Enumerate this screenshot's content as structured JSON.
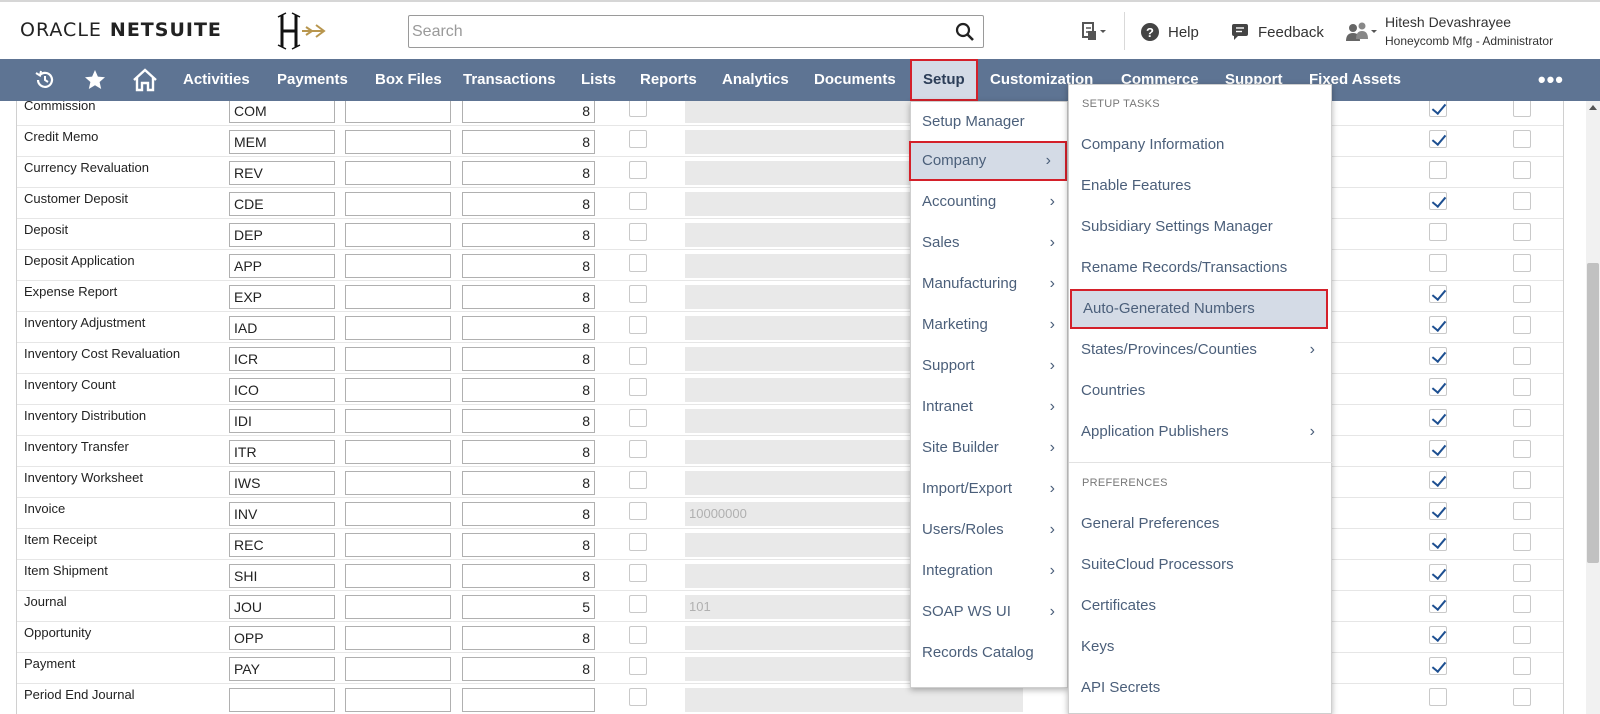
{
  "header": {
    "logo_oracle": "ORACLE",
    "logo_netsuite": "NETSUITE",
    "search_placeholder": "Search",
    "help_label": "Help",
    "feedback_label": "Feedback",
    "user_name": "Hitesh Devashrayee",
    "user_role": "Honeycomb Mfg - Administrator"
  },
  "nav": {
    "items": [
      "Activities",
      "Payments",
      "Box Files",
      "Transactions",
      "Lists",
      "Reports",
      "Analytics",
      "Documents",
      "Setup",
      "Customization",
      "Commerce",
      "Support",
      "Fixed Assets"
    ],
    "more": "•••"
  },
  "table": {
    "rows": [
      {
        "name": "Commission",
        "prefix": "COM",
        "suffix": "",
        "min_digits": "8",
        "initial": "",
        "use_a": true,
        "use_b": false
      },
      {
        "name": "Credit Memo",
        "prefix": "MEM",
        "suffix": "",
        "min_digits": "8",
        "initial": "",
        "use_a": true,
        "use_b": false
      },
      {
        "name": "Currency Revaluation",
        "prefix": "REV",
        "suffix": "",
        "min_digits": "8",
        "initial": "",
        "use_a": false,
        "use_b": false
      },
      {
        "name": "Customer Deposit",
        "prefix": "CDE",
        "suffix": "",
        "min_digits": "8",
        "initial": "",
        "use_a": true,
        "use_b": false
      },
      {
        "name": "Deposit",
        "prefix": "DEP",
        "suffix": "",
        "min_digits": "8",
        "initial": "",
        "use_a": false,
        "use_b": false
      },
      {
        "name": "Deposit Application",
        "prefix": "APP",
        "suffix": "",
        "min_digits": "8",
        "initial": "",
        "use_a": false,
        "use_b": false
      },
      {
        "name": "Expense Report",
        "prefix": "EXP",
        "suffix": "",
        "min_digits": "8",
        "initial": "",
        "use_a": true,
        "use_b": false
      },
      {
        "name": "Inventory Adjustment",
        "prefix": "IAD",
        "suffix": "",
        "min_digits": "8",
        "initial": "",
        "use_a": true,
        "use_b": false
      },
      {
        "name": "Inventory Cost Revaluation",
        "prefix": "ICR",
        "suffix": "",
        "min_digits": "8",
        "initial": "",
        "use_a": true,
        "use_b": false
      },
      {
        "name": "Inventory Count",
        "prefix": "ICO",
        "suffix": "",
        "min_digits": "8",
        "initial": "",
        "use_a": true,
        "use_b": false
      },
      {
        "name": "Inventory Distribution",
        "prefix": "IDI",
        "suffix": "",
        "min_digits": "8",
        "initial": "",
        "use_a": true,
        "use_b": false
      },
      {
        "name": "Inventory Transfer",
        "prefix": "ITR",
        "suffix": "",
        "min_digits": "8",
        "initial": "",
        "use_a": true,
        "use_b": false
      },
      {
        "name": "Inventory Worksheet",
        "prefix": "IWS",
        "suffix": "",
        "min_digits": "8",
        "initial": "",
        "use_a": true,
        "use_b": false
      },
      {
        "name": "Invoice",
        "prefix": "INV",
        "suffix": "",
        "min_digits": "8",
        "initial": "10000000",
        "use_a": true,
        "use_b": false
      },
      {
        "name": "Item Receipt",
        "prefix": "REC",
        "suffix": "",
        "min_digits": "8",
        "initial": "",
        "use_a": true,
        "use_b": false
      },
      {
        "name": "Item Shipment",
        "prefix": "SHI",
        "suffix": "",
        "min_digits": "8",
        "initial": "",
        "use_a": true,
        "use_b": false
      },
      {
        "name": "Journal",
        "prefix": "JOU",
        "suffix": "",
        "min_digits": "5",
        "initial": "101",
        "use_a": true,
        "use_b": false
      },
      {
        "name": "Opportunity",
        "prefix": "OPP",
        "suffix": "",
        "min_digits": "8",
        "initial": "",
        "use_a": true,
        "use_b": false
      },
      {
        "name": "Payment",
        "prefix": "PAY",
        "suffix": "",
        "min_digits": "8",
        "initial": "",
        "use_a": true,
        "use_b": false
      },
      {
        "name": "Period End Journal",
        "prefix": "",
        "suffix": "",
        "min_digits": "",
        "initial": "",
        "use_a": false,
        "use_b": false
      }
    ]
  },
  "setup_menu": {
    "items": [
      {
        "label": "Setup Manager",
        "submenu": false
      },
      {
        "label": "Company",
        "submenu": true,
        "highlight": true
      },
      {
        "label": "Accounting",
        "submenu": true
      },
      {
        "label": "Sales",
        "submenu": true
      },
      {
        "label": "Manufacturing",
        "submenu": true
      },
      {
        "label": "Marketing",
        "submenu": true
      },
      {
        "label": "Support",
        "submenu": true
      },
      {
        "label": "Intranet",
        "submenu": true
      },
      {
        "label": "Site Builder",
        "submenu": true
      },
      {
        "label": "Import/Export",
        "submenu": true
      },
      {
        "label": "Users/Roles",
        "submenu": true
      },
      {
        "label": "Integration",
        "submenu": true
      },
      {
        "label": "SOAP WS UI",
        "submenu": true
      },
      {
        "label": "Records Catalog",
        "submenu": false
      }
    ]
  },
  "company_menu": {
    "setup_tasks_heading": "SETUP TASKS",
    "setup_tasks": [
      {
        "label": "Company Information",
        "submenu": false
      },
      {
        "label": "Enable Features",
        "submenu": false
      },
      {
        "label": "Subsidiary Settings Manager",
        "submenu": false
      },
      {
        "label": "Rename Records/Transactions",
        "submenu": false
      },
      {
        "label": "Auto-Generated Numbers",
        "submenu": false,
        "highlight": true
      },
      {
        "label": "States/Provinces/Counties",
        "submenu": true
      },
      {
        "label": "Countries",
        "submenu": false
      },
      {
        "label": "Application Publishers",
        "submenu": true
      }
    ],
    "preferences_heading": "PREFERENCES",
    "preferences": [
      {
        "label": "General Preferences",
        "submenu": false
      },
      {
        "label": "SuiteCloud Processors",
        "submenu": false
      },
      {
        "label": "Certificates",
        "submenu": false
      },
      {
        "label": "Keys",
        "submenu": false
      },
      {
        "label": "API Secrets",
        "submenu": false
      }
    ]
  },
  "colors": {
    "nav_bg": "#5e7493",
    "highlight_border": "#d4202a",
    "highlight_bg": "#d4dbe6",
    "menu_text": "#4b5f7a",
    "check": "#1d4f91"
  }
}
